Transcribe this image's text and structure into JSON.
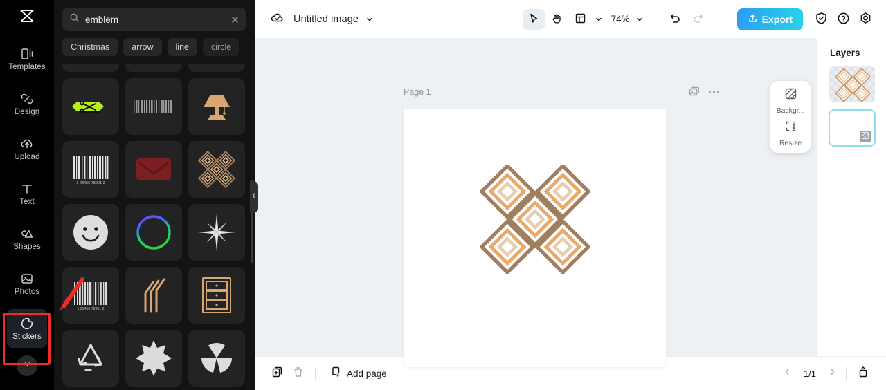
{
  "rail": {
    "logo_icon": "capcut-logo-icon",
    "items": [
      {
        "label": "Templates",
        "icon": "templates-icon",
        "active": false
      },
      {
        "label": "Design",
        "icon": "design-icon",
        "active": false
      },
      {
        "label": "Upload",
        "icon": "upload-cloud-icon",
        "active": false
      },
      {
        "label": "Text",
        "icon": "text-icon",
        "active": false
      },
      {
        "label": "Shapes",
        "icon": "shapes-icon",
        "active": false
      },
      {
        "label": "Photos",
        "icon": "photos-icon",
        "active": false
      },
      {
        "label": "Stickers",
        "icon": "stickers-icon",
        "active": true
      }
    ],
    "more_icon": "chevron-down-icon"
  },
  "panel": {
    "search": {
      "value": "emblem",
      "placeholder": "Search",
      "icon": "search-icon",
      "clear_icon": "close-icon"
    },
    "chips": [
      "Christmas",
      "arrow",
      "line",
      "circle"
    ],
    "stickers": [
      {
        "name": "scissors-coupon-sticker",
        "row": 0
      },
      {
        "name": "barcode-thin-sticker",
        "row": 0
      },
      {
        "name": "lamp-sticker",
        "row": 0
      },
      {
        "name": "scissors-cut-line-sticker"
      },
      {
        "name": "barcode-blurred-sticker"
      },
      {
        "name": "table-lamp-sticker"
      },
      {
        "name": "barcode-sticker"
      },
      {
        "name": "envelope-sticker"
      },
      {
        "name": "emblem-diamond-sticker"
      },
      {
        "name": "smiley-face-sticker"
      },
      {
        "name": "gradient-ring-sticker"
      },
      {
        "name": "sparkle-star-sticker"
      },
      {
        "name": "barcode-numbers-sticker"
      },
      {
        "name": "straws-sticker"
      },
      {
        "name": "drawer-cabinet-sticker"
      },
      {
        "name": "recycle-sticker"
      },
      {
        "name": "eight-point-star-sticker"
      },
      {
        "name": "radiation-sticker"
      }
    ],
    "collapse_icon": "chevron-left-icon"
  },
  "topbar": {
    "cloud_icon": "cloud-saved-icon",
    "title": "Untitled image",
    "title_caret": "chevron-down-icon",
    "tools": [
      {
        "name": "select-tool",
        "icon": "cursor-arrow-icon",
        "selected": true
      },
      {
        "name": "hand-tool",
        "icon": "hand-icon",
        "selected": false
      },
      {
        "name": "layout-tool",
        "icon": "layout-grid-icon",
        "selected": false
      }
    ],
    "layout_caret": "chevron-down-icon",
    "zoom": "74%",
    "zoom_caret": "chevron-down-icon",
    "undo_icon": "undo-icon",
    "redo_icon": "redo-icon",
    "export_label": "Export",
    "export_icon": "upload-arrow-icon",
    "shield_icon": "shield-check-icon",
    "help_icon": "question-circle-icon",
    "settings_icon": "gear-icon"
  },
  "canvas": {
    "page_label": "Page 1",
    "duplicate_page_icon": "duplicate-image-icon",
    "more_icon": "more-horizontal-icon",
    "artwork_name": "emblem-diamond-artwork"
  },
  "float_panel": {
    "items": [
      {
        "label": "Backgr...",
        "icon": "background-swatch-icon",
        "name": "background-button"
      },
      {
        "label": "Resize",
        "icon": "resize-icon",
        "name": "resize-button"
      }
    ]
  },
  "layers": {
    "title": "Layers",
    "items": [
      {
        "name": "layer-emblem",
        "selected": false,
        "kind": "artwork"
      },
      {
        "name": "layer-background",
        "selected": true,
        "kind": "background"
      }
    ],
    "badge_icon": "background-swatch-icon"
  },
  "bottombar": {
    "duplicate_icon": "duplicate-page-icon",
    "delete_icon": "trash-icon",
    "add_page_label": "Add page",
    "add_page_icon": "add-page-icon",
    "prev_icon": "chevron-left-icon",
    "page_indicator": "1/1",
    "next_icon": "chevron-right-icon",
    "pages_panel_icon": "pages-panel-icon"
  },
  "annotation": {
    "highlight_target": "Stickers",
    "color": "#ef2b2b"
  },
  "colors": {
    "accent_start": "#2b9cf5",
    "accent_end": "#27d4e8",
    "panel_bg": "#131313",
    "rail_bg": "#000000",
    "canvas_bg": "#eef1f4",
    "emblem_outer": "#a07e5e",
    "emblem_mid": "#e8a96b",
    "emblem_inner": "#e8cdae"
  }
}
